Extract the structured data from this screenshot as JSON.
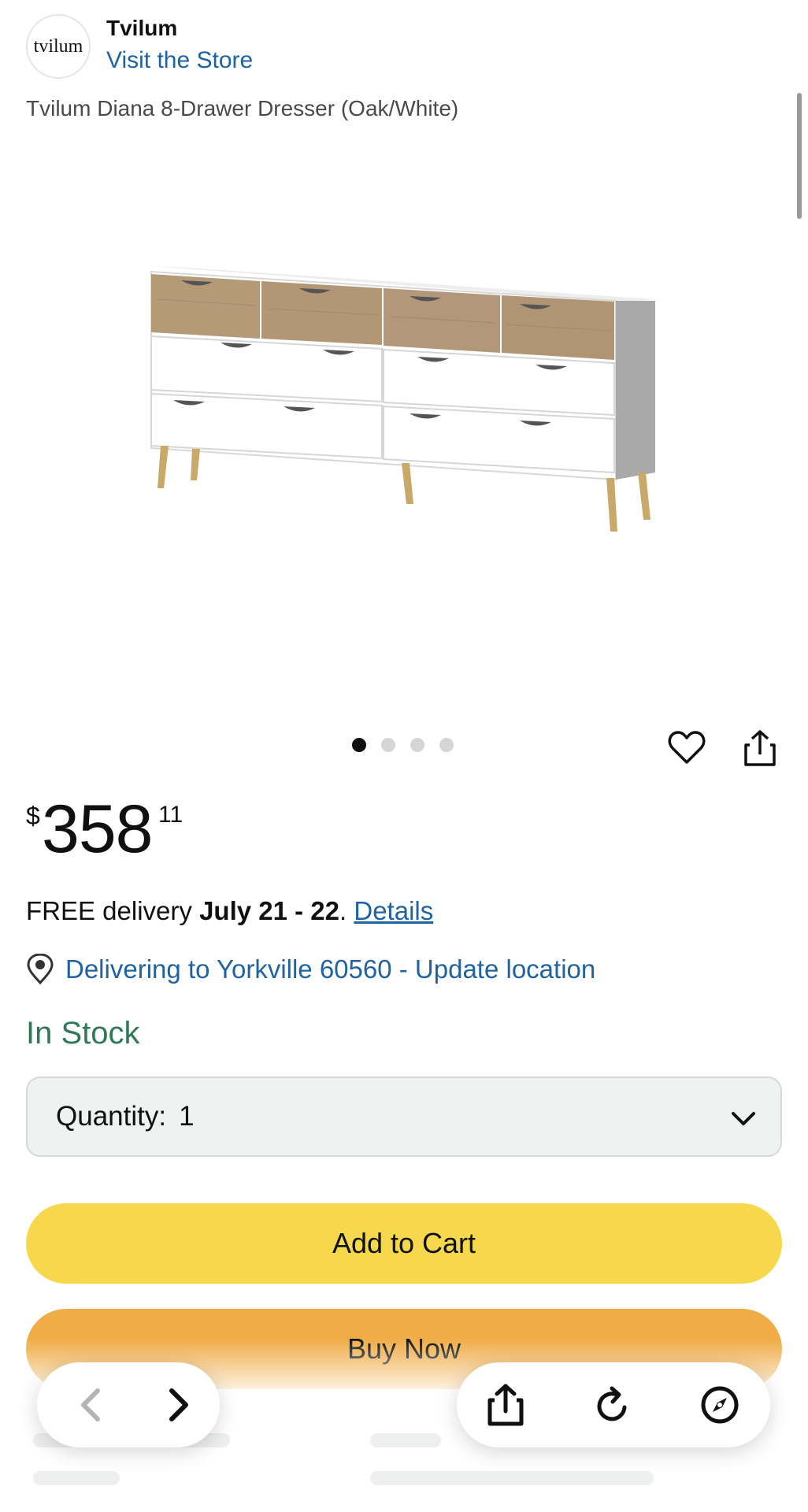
{
  "brand": {
    "logo_text": "tvilum",
    "name": "Tvilum",
    "store_link": "Visit the Store"
  },
  "product": {
    "title": "Tvilum Diana 8-Drawer Dresser (Oak/White)",
    "image_alt": "Tvilum Diana 8-Drawer Dresser"
  },
  "gallery": {
    "dot_count": 4,
    "active_index": 0
  },
  "actions": {
    "wishlist_icon": "heart-icon",
    "share_icon": "share-icon"
  },
  "price": {
    "symbol": "$",
    "whole": "358",
    "fraction": "11"
  },
  "delivery": {
    "prefix": "FREE delivery ",
    "dates": "July 21 - 22",
    "separator": ". ",
    "details_link": "Details"
  },
  "location": {
    "icon": "location-pin-icon",
    "text": "Delivering to Yorkville 60560 - Update location"
  },
  "stock": {
    "status": "In Stock"
  },
  "quantity": {
    "label": "Quantity:",
    "value": "1"
  },
  "buttons": {
    "add_to_cart": "Add to Cart",
    "buy_now": "Buy Now"
  },
  "browser_toolbar": {
    "back_icon": "chevron-left-icon",
    "forward_icon": "chevron-right-icon",
    "share_icon": "share-icon",
    "reload_icon": "reload-icon",
    "compass_icon": "compass-icon"
  },
  "colors": {
    "link": "#2162a1",
    "in_stock": "#2f7a56",
    "add_to_cart_bg": "#f7d84c",
    "buy_now_bg": "#f0ac47",
    "quantity_bg": "#f0f2f2"
  }
}
